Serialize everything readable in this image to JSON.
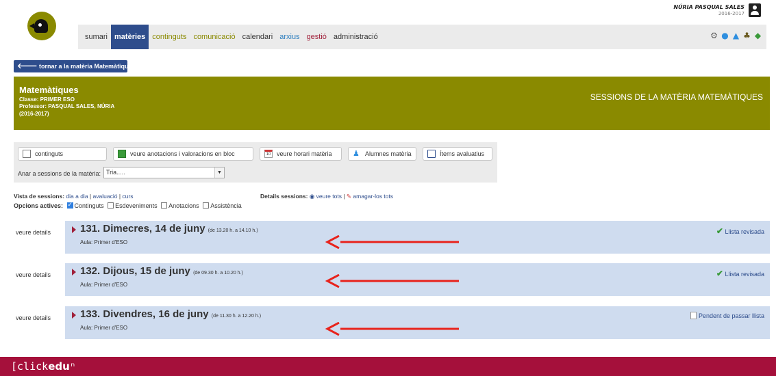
{
  "header": {
    "user_name": "NÚRIA PASQUAL SALES",
    "user_year": "2016-2017",
    "menu": [
      {
        "label": "sumari"
      },
      {
        "label": "matèries"
      },
      {
        "label": "continguts"
      },
      {
        "label": "comunicació"
      },
      {
        "label": "calendari"
      },
      {
        "label": "arxius"
      },
      {
        "label": "gestió"
      },
      {
        "label": "administració"
      }
    ],
    "tool_icons": [
      "gear-icon",
      "chat-icon",
      "user-icon",
      "users-icon",
      "leaf-icon"
    ]
  },
  "back_button": {
    "label": "tornar a la matèria Matemàtiques"
  },
  "banner": {
    "title": "Matemàtiques",
    "classe": "Classe: PRIMER ESO",
    "professor": "Professor: PASQUAL SALES, NÚRIA",
    "year": "(2016-2017)",
    "right_title": "SESSIONS DE LA MATÈRIA MATEMÀTIQUES"
  },
  "panel": {
    "buttons": [
      {
        "label": "continguts",
        "icon": "document-icon"
      },
      {
        "label": "veure anotacions i valoracions en bloc",
        "icon": "grid-icon"
      },
      {
        "label": "veure horari matèria",
        "icon": "calendar-icon"
      },
      {
        "label": "Alumnes matèria",
        "icon": "students-icon"
      },
      {
        "label": "Ítems avaluatius",
        "icon": "book-icon"
      }
    ],
    "calendar_day": "10",
    "anar_label": "Anar a sessions de la matèria:",
    "select_value": "Tria....."
  },
  "vista": {
    "label": "Vista de sessions:",
    "dia": "dia a dia",
    "avaluacio": "avaluació",
    "curs": "curs",
    "sep": "|"
  },
  "opcions": {
    "label": "Opcions actives:",
    "items": [
      {
        "label": "Continguts",
        "checked": true
      },
      {
        "label": "Esdeveniments",
        "checked": false
      },
      {
        "label": "Anotacions",
        "checked": false
      },
      {
        "label": "Assistència",
        "checked": false
      }
    ]
  },
  "details": {
    "label": "Details sessions:",
    "show_all": "veure tots",
    "hide_all": "amagar-los tots",
    "sep": "|"
  },
  "sessions": [
    {
      "side_label": "veure details",
      "title": "131. Dimecres, 14 de juny",
      "time": "(de 13.20 h. a 14.10 h.)",
      "aula": "Aula: Primer d'ESO",
      "status": "Llista revisada",
      "status_type": "ok"
    },
    {
      "side_label": "veure details",
      "title": "132. Dijous, 15 de juny",
      "time": "(de 09.30 h. a 10.20 h.)",
      "aula": "Aula: Primer d'ESO",
      "status": "Llista revisada",
      "status_type": "ok"
    },
    {
      "side_label": "veure details",
      "title": "133. Divendres, 16 de juny",
      "time": "(de 11.30 h. a 12.20 h.)",
      "aula": "Aula: Primer d'ESO",
      "status": "Pendent de passar llista",
      "status_type": "pending"
    }
  ],
  "footer": {
    "logo_click": "[click",
    "logo_edu": "edu",
    "logo_mark": "ⁿ"
  },
  "colors": {
    "olive": "#8a8a00",
    "navy": "#2e4d8c",
    "footer": "#a5103b",
    "session_bg": "#cfdcef",
    "arrow": "#e8231c"
  }
}
